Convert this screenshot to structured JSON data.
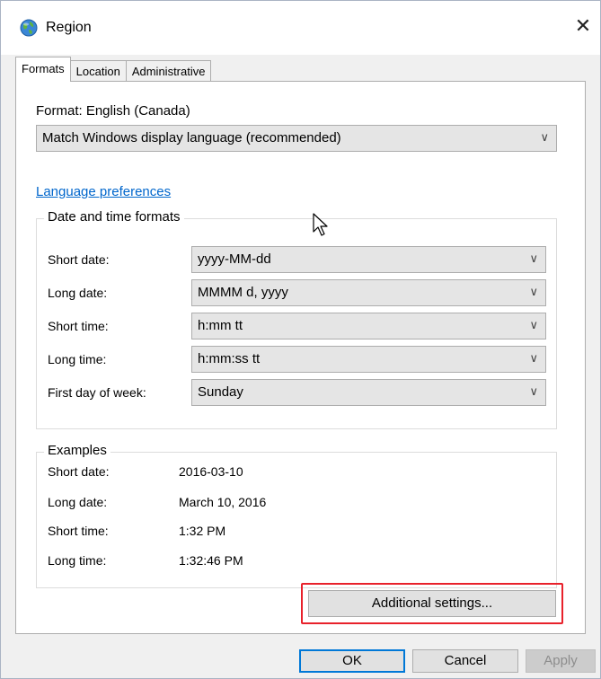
{
  "window": {
    "title": "Region",
    "close_glyph": "✕"
  },
  "tabs": [
    {
      "label": "Formats",
      "active": true
    },
    {
      "label": "Location",
      "active": false
    },
    {
      "label": "Administrative",
      "active": false
    }
  ],
  "formats": {
    "format_label": "Format: English (Canada)",
    "format_dropdown": "Match Windows display language (recommended)",
    "language_link": "Language preferences",
    "date_time_group": {
      "title": "Date and time formats",
      "rows": [
        {
          "label": "Short date:",
          "value": "yyyy-MM-dd"
        },
        {
          "label": "Long date:",
          "value": "MMMM d, yyyy"
        },
        {
          "label": "Short time:",
          "value": "h:mm tt"
        },
        {
          "label": "Long time:",
          "value": "h:mm:ss tt"
        },
        {
          "label": "First day of week:",
          "value": "Sunday"
        }
      ]
    },
    "examples_group": {
      "title": "Examples",
      "rows": [
        {
          "label": "Short date:",
          "value": "2016-03-10"
        },
        {
          "label": "Long date:",
          "value": "March 10, 2016"
        },
        {
          "label": "Short time:",
          "value": "1:32 PM"
        },
        {
          "label": "Long time:",
          "value": "1:32:46 PM"
        }
      ]
    },
    "additional_settings_label": "Additional settings..."
  },
  "buttons": {
    "ok": "OK",
    "cancel": "Cancel",
    "apply": "Apply"
  },
  "icons": {
    "dropdown_arrow": "∨"
  },
  "colors": {
    "link": "#0066cc",
    "highlight": "#e8212b",
    "focus_border": "#0078d7"
  }
}
